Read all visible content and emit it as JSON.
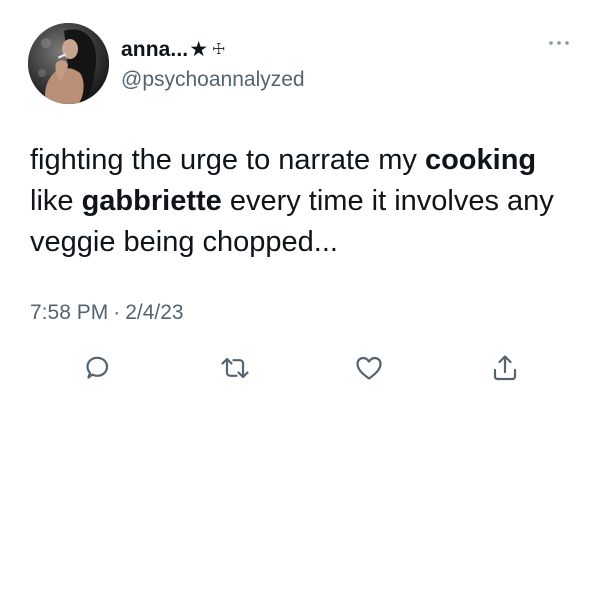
{
  "author": {
    "display_name": "anna...",
    "name_star": "★",
    "name_cross": "☩",
    "handle": "@psychoannalyzed",
    "avatar_icon": "profile-photo"
  },
  "tweet": {
    "text_parts": [
      "fighting the urge to narrate my ",
      "cooking",
      " like ",
      "gabbriette",
      " every time it involves any veggie being chopped..."
    ],
    "time": "7:58 PM",
    "separator": "·",
    "date": "2/4/23"
  },
  "actions": {
    "reply_icon": "reply-icon",
    "retweet_icon": "retweet-icon",
    "like_icon": "heart-icon",
    "share_icon": "share-icon",
    "more_icon": "more-icon"
  },
  "colors": {
    "text": "#0f1419",
    "secondary": "#536471",
    "background": "#ffffff"
  }
}
